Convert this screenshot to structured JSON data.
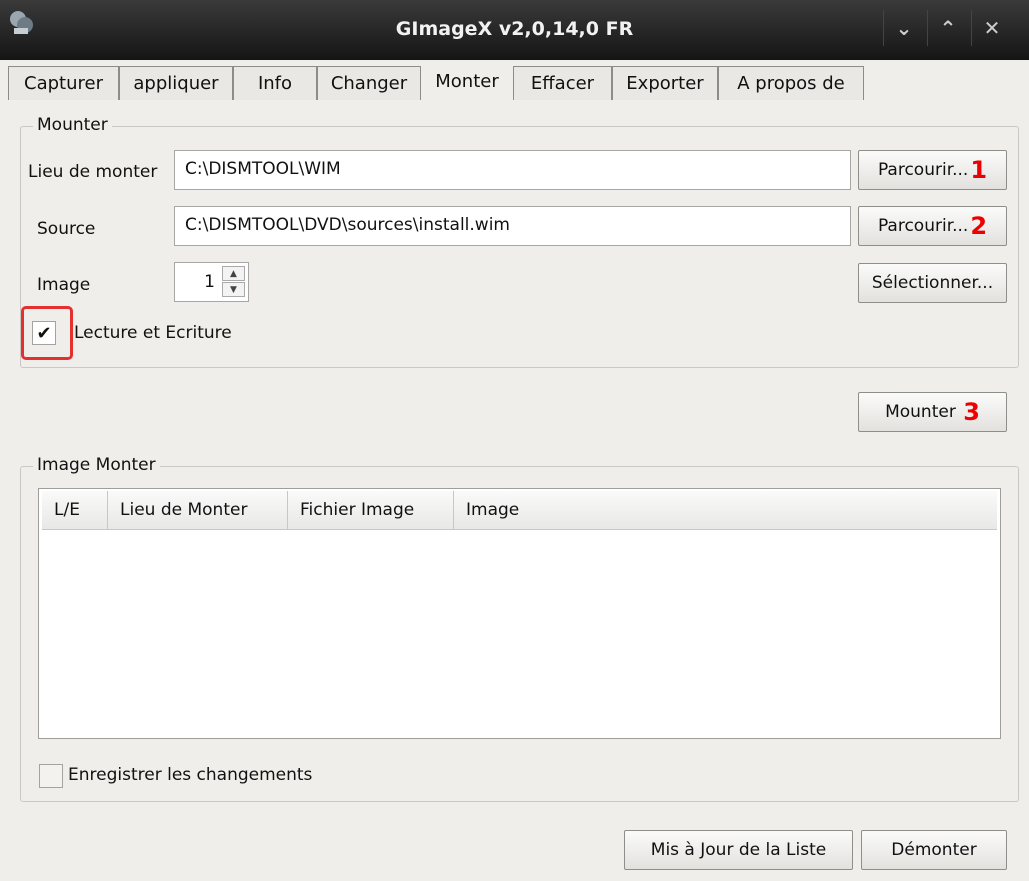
{
  "window": {
    "title": "GImageX v2,0,14,0 FR"
  },
  "tabs": [
    "Capturer",
    "appliquer",
    "Info",
    "Changer",
    "Monter",
    "Effacer",
    "Exporter",
    "A propos de"
  ],
  "mount_group": {
    "label": "Mounter",
    "location_label": "Lieu de monter",
    "location_value": "C:\\DISMTOOL\\WIM",
    "source_label": "Source",
    "source_value": "C:\\DISMTOOL\\DVD\\sources\\install.wim",
    "image_label": "Image",
    "image_value": "1",
    "browse1_label": "Parcourir...",
    "browse1_number": "1",
    "browse2_label": "Parcourir...",
    "browse2_number": "2",
    "select_label": "Sélectionner...",
    "readwrite_label": "Lecture et Ecriture",
    "readwrite_checked": true
  },
  "mount_button": {
    "label": "Mounter",
    "number": "3"
  },
  "mounted_group": {
    "label": "Image Monter",
    "columns": [
      "L/E",
      "Lieu de Monter",
      "Fichier Image",
      "Image"
    ],
    "save_changes_label": "Enregistrer les changements",
    "save_changes_checked": false
  },
  "footer": {
    "refresh_label": "Mis à Jour de la Liste",
    "unmount_label": "Démonter"
  },
  "colors": {
    "annotation_red": "#e53030",
    "titlebar": "#1f1f1f",
    "background": "#efeeeb"
  },
  "icons": [
    "app-icon",
    "minimize-icon",
    "maximize-icon",
    "close-icon",
    "checkmark-icon",
    "spin-up-icon",
    "spin-down-icon"
  ]
}
